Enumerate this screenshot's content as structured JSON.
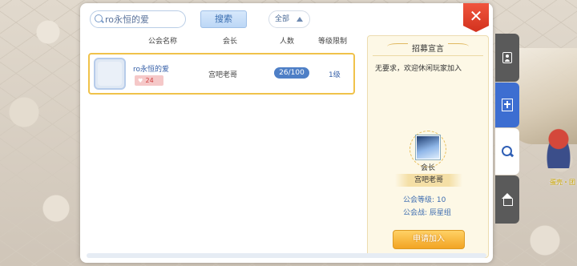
{
  "search": {
    "value": "ro永恒的爱",
    "placeholder": "ro永恒的爱",
    "button_label": "搜索"
  },
  "filter": {
    "selected": "全部"
  },
  "close_label": "✕",
  "table": {
    "headers": [
      "公会名称",
      "会长",
      "人数",
      "等级限制"
    ],
    "rows": [
      {
        "name": "ro永恒的爱",
        "level": "24",
        "leader": "宫吧老哥",
        "members": "26/100",
        "level_limit": "1级"
      }
    ]
  },
  "info": {
    "title": "招募宣言",
    "recruit_text": "无要求，欢迎休闲玩家加入",
    "leader_caption": "会长",
    "leader_name": "宫吧老哥",
    "guild_level": "公会等级: 10",
    "guild_war": "公会战: 辰星组",
    "apply_label": "申请加入"
  },
  "npc_label": "蛋壳・团",
  "colors": {
    "accent_blue": "#3d6ed1",
    "highlight_gold": "#f0c24a",
    "apply_orange": "#f2a423",
    "close_red": "#d2321e"
  },
  "icons": {
    "tab_profile": "id-card-icon",
    "tab_guild": "guild-book-icon",
    "tab_search": "magnifier-icon",
    "tab_home": "guild-home-icon"
  }
}
